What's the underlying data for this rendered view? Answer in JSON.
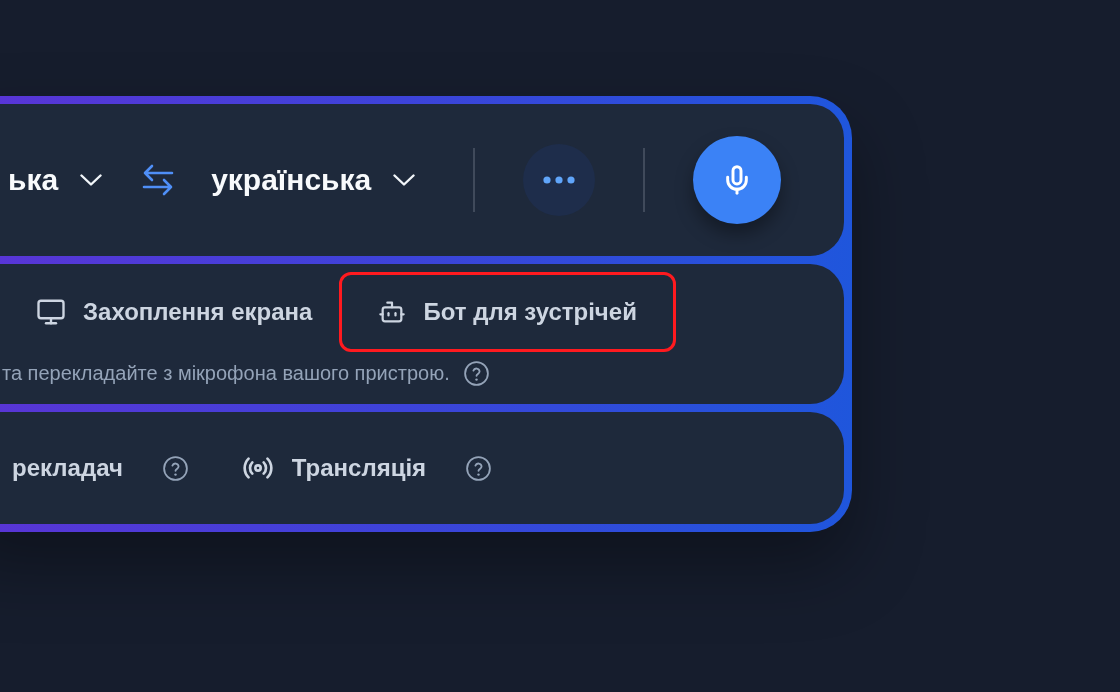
{
  "language_bar": {
    "source_language": "ька",
    "target_language": "українська"
  },
  "input_modes": {
    "tabs": [
      {
        "label": "Захоплення екрана",
        "kind": "screen",
        "highlighted": false
      },
      {
        "label": "Бот для зустрічей",
        "kind": "bot",
        "highlighted": true
      }
    ],
    "hint": "та перекладайте з мікрофона вашого пристрою."
  },
  "output_modes": [
    {
      "label": "рекладач",
      "kind": "plain"
    },
    {
      "label": "Трансляція",
      "kind": "broadcast"
    }
  ]
}
